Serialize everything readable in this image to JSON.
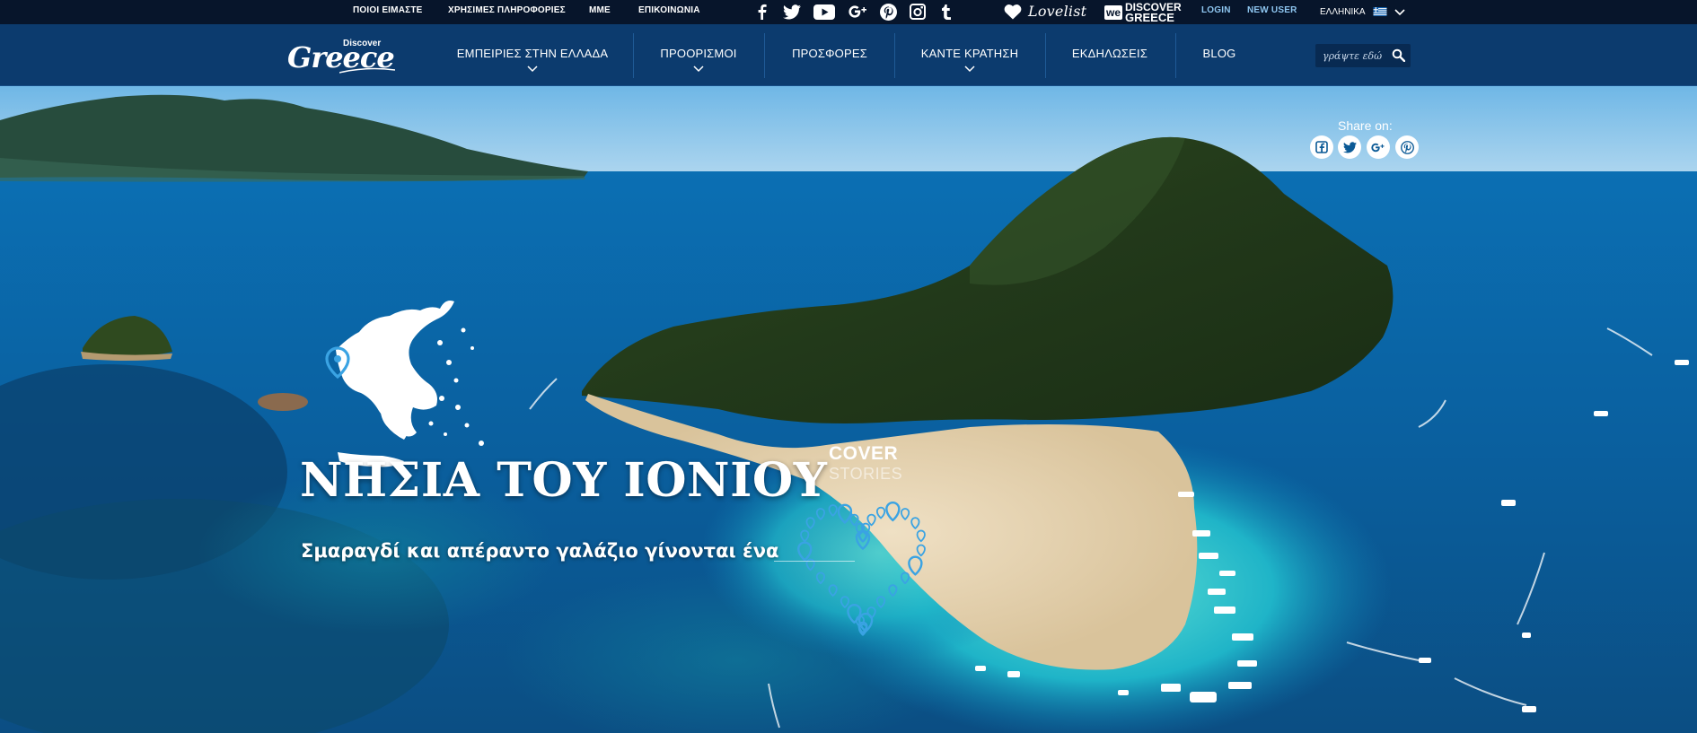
{
  "topbar": {
    "links": [
      "ΠΟΙΟΙ ΕΙΜΑΣΤΕ",
      "ΧΡΗΣΙΜΕΣ ΠΛΗΡΟΦΟΡΙΕΣ",
      "ΜΜΕ",
      "ΕΠΙΚΟΙΝΩΝΙΑ"
    ],
    "social_icons": [
      "facebook-icon",
      "twitter-icon",
      "youtube-icon",
      "google-plus-icon",
      "pinterest-icon",
      "instagram-icon",
      "tumblr-icon"
    ],
    "lovelist": "Lovelist",
    "we_discover_logo_text": [
      "we",
      "DISCOVER",
      "GREECE"
    ],
    "login": "LOGIN",
    "new_user": "NEW USER",
    "language": "ΕΛΛΗΝΙΚΑ"
  },
  "logo": {
    "small": "Discover",
    "large": "Greece"
  },
  "nav": {
    "items": [
      {
        "label": "ΕΜΠΕΙΡΙΕΣ ΣΤΗΝ ΕΛΛΑΔΑ",
        "dropdown": true
      },
      {
        "label": "ΠΡΟΟΡΙΣΜΟΙ",
        "dropdown": true
      },
      {
        "label": "ΠΡΟΣΦΟΡΕΣ",
        "dropdown": false
      },
      {
        "label": "ΚΑΝΤΕ ΚΡΑΤΗΣΗ",
        "dropdown": true
      },
      {
        "label": "ΕΚΔΗΛΩΣΕΙΣ",
        "dropdown": false
      },
      {
        "label": "BLOG",
        "dropdown": false
      }
    ],
    "search_placeholder": "γράψτε εδώ"
  },
  "hero": {
    "share_label": "Share on:",
    "share_icons": [
      "facebook-icon",
      "twitter-icon",
      "google-plus-icon",
      "pinterest-icon"
    ],
    "title": "ΝΗΣΙΑ ΤΟΥ ΙΟΝΙΟΥ",
    "subtitle": "Σμαραγδί και απέραντο γαλάζιο γίνονται ένα",
    "badge_line1": "COVER",
    "badge_line2": "STORIES"
  },
  "colors": {
    "topbar_bg": "#07152b",
    "nav_bg": "#0c3b6e",
    "accent_blue": "#3aa3e3",
    "link_blue": "#8ec6f0"
  }
}
